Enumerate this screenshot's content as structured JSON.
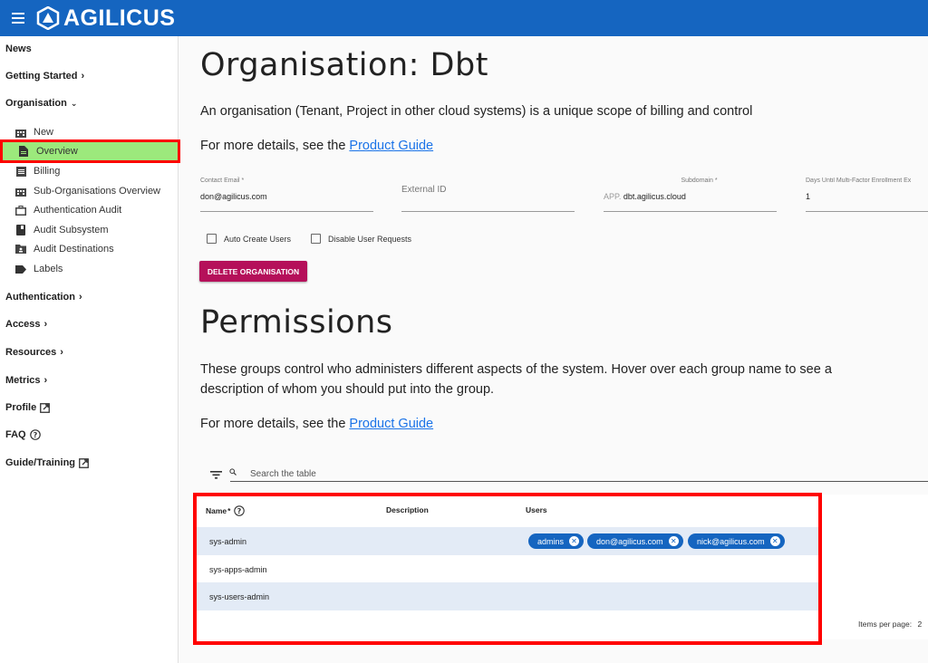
{
  "app": {
    "logo_text": "AGILICUS"
  },
  "sidebar": {
    "news": "News",
    "getting_started": "Getting Started",
    "organisation": "Organisation",
    "org_items": [
      {
        "label": "New",
        "icon": "building-icon"
      },
      {
        "label": "Overview",
        "icon": "document-icon"
      },
      {
        "label": "Billing",
        "icon": "list-icon"
      },
      {
        "label": "Sub-Organisations Overview",
        "icon": "building-icon"
      },
      {
        "label": "Authentication Audit",
        "icon": "briefcase-icon"
      },
      {
        "label": "Audit Subsystem",
        "icon": "book-icon"
      },
      {
        "label": "Audit Destinations",
        "icon": "folder-user-icon"
      },
      {
        "label": "Labels",
        "icon": "label-icon"
      }
    ],
    "authentication": "Authentication",
    "access": "Access",
    "resources": "Resources",
    "metrics": "Metrics",
    "profile": "Profile",
    "faq": "FAQ",
    "guide": "Guide/Training"
  },
  "main": {
    "title": "Organisation: Dbt",
    "description": "An organisation (Tenant, Project in other cloud systems) is a unique scope of billing and control",
    "details_prefix": "For more details, see the",
    "product_guide": "Product Guide",
    "fields": {
      "contact_email_label": "Contact Email",
      "contact_email_value": "don@agilicus.com",
      "external_id_placeholder": "External ID",
      "subdomain_label": "Subdomain",
      "subdomain_prefix": "APP.",
      "subdomain_value": "dbt.agilicus.cloud",
      "mfa_label": "Days Until Multi-Factor Enrollment Ex",
      "mfa_value": "1"
    },
    "checkboxes": {
      "auto_create": "Auto Create Users",
      "disable_requests": "Disable User Requests"
    },
    "delete_button": "DELETE ORGANISATION",
    "permissions_title": "Permissions",
    "permissions_desc_1": "These groups control who administers different aspects of the system. Hover over each group name to see a",
    "permissions_desc_2": "description of whom you should put into the group.",
    "search_placeholder": "Search the table"
  },
  "table": {
    "headers": {
      "name": "Name",
      "description": "Description",
      "users": "Users"
    },
    "rows": [
      {
        "name": "sys-admin",
        "users": [
          "admins",
          "don@agilicus.com",
          "nick@agilicus.com"
        ]
      },
      {
        "name": "sys-apps-admin",
        "users": []
      },
      {
        "name": "sys-users-admin",
        "users": []
      }
    ],
    "items_per_page": "Items per page:",
    "items_per_page_value": "2"
  },
  "colors": {
    "topbar": "#1565c0",
    "chip": "#1565c0",
    "delete": "#b5105a",
    "active_nav": "#9ce97c",
    "highlight": "#ff0000"
  }
}
